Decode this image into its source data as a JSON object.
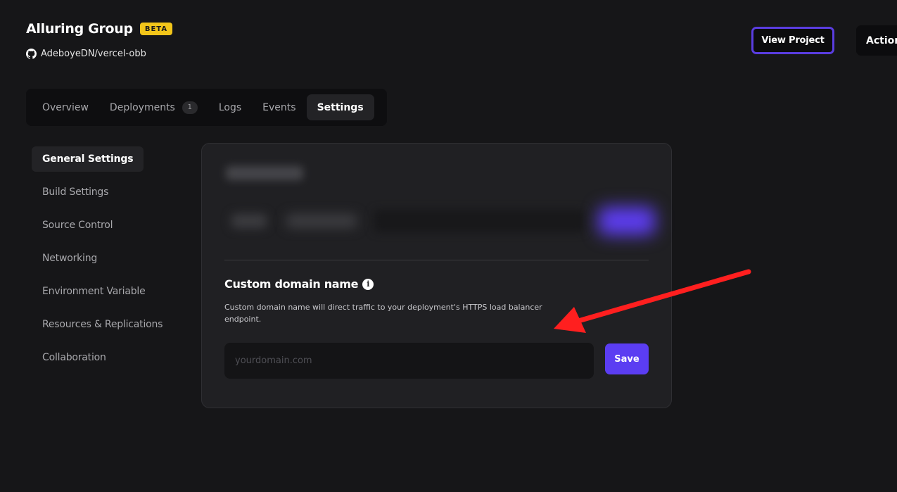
{
  "header": {
    "project_name": "Alluring Group",
    "badge": "BETA",
    "repo": "AdeboyeDN/vercel-obb",
    "view_project_label": "View Project",
    "actions_label": "Action"
  },
  "tabs": [
    {
      "label": "Overview"
    },
    {
      "label": "Deployments",
      "count": "1"
    },
    {
      "label": "Logs"
    },
    {
      "label": "Events"
    },
    {
      "label": "Settings",
      "active": true
    }
  ],
  "sidebar": {
    "items": [
      {
        "label": "General Settings",
        "active": true
      },
      {
        "label": "Build Settings"
      },
      {
        "label": "Source Control"
      },
      {
        "label": "Networking"
      },
      {
        "label": "Environment Variable"
      },
      {
        "label": "Resources & Replications"
      },
      {
        "label": "Collaboration"
      }
    ]
  },
  "custom_domain": {
    "title": "Custom domain name",
    "description": "Custom domain name will direct traffic to your deployment's HTTPS load balancer endpoint.",
    "input_value": "",
    "input_placeholder": "yourdomain.com",
    "save_label": "Save"
  },
  "icons": {
    "repo": "github-icon",
    "info": "info-icon"
  },
  "colors": {
    "accent": "#5b3df2",
    "badge": "#f2c51a",
    "background": "#161618",
    "card": "#202023",
    "annotation_arrow": "#ff1f1f"
  }
}
